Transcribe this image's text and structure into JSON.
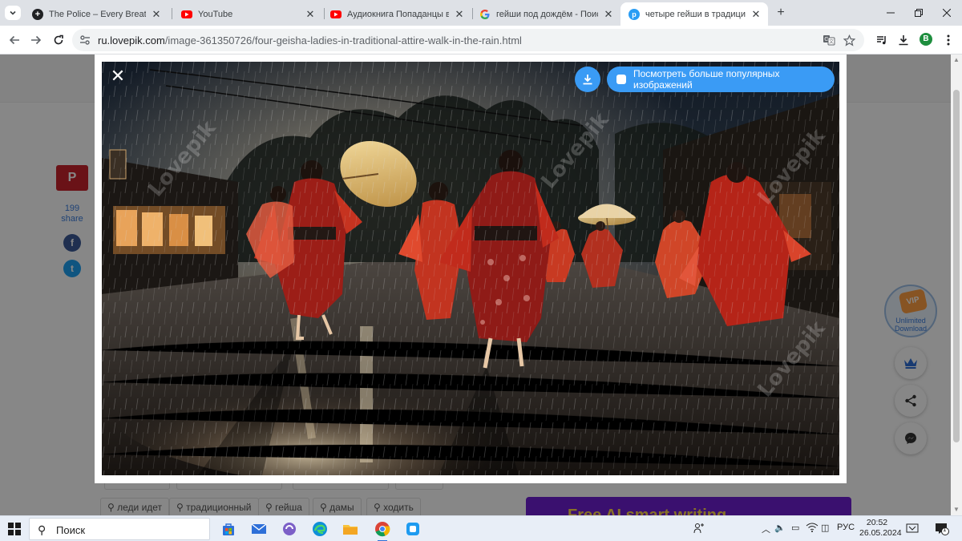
{
  "browser": {
    "tabs": [
      {
        "title": "The Police – Every Breath You Ta",
        "favicon": "plus-circle-icon",
        "close": "✕",
        "active": false
      },
      {
        "title": "YouTube",
        "favicon": "youtube-icon",
        "close": "✕",
        "active": false
      },
      {
        "title": "Аудиокнига Попаданцы в про",
        "favicon": "youtube-icon",
        "close": "✕",
        "active": false
      },
      {
        "title": "гейши под дождём - Поиск в",
        "favicon": "google-icon",
        "close": "✕",
        "active": false
      },
      {
        "title": "четыре гейши в традиционны",
        "favicon": "lovepik-icon",
        "close": "✕",
        "active": true
      }
    ],
    "new_tab_label": "+",
    "url_host": "ru.lovepik.com",
    "url_path": "/image-361350726/four-geisha-ladies-in-traditional-attire-walk-in-the-rain.html",
    "profile_initial": "B"
  },
  "page": {
    "share_count": "199",
    "share_label": "share",
    "pinterest_label": "P",
    "facebook_label": "f",
    "twitter_label": "t",
    "vip_badge_text": "VIP",
    "vip_label_line1": "Unlimited",
    "vip_label_line2": "Download",
    "tags": [
      "леди идет",
      "традиционный",
      "гейша",
      "дамы",
      "ходить"
    ],
    "promo_text": "Free AI smart writing"
  },
  "modal": {
    "close_label": "✕",
    "more_button_label": "Посмотреть больше популярных изображений",
    "watermark": "Lovepik",
    "accent_color": "#3a9bf5"
  },
  "taskbar": {
    "search_placeholder": "Поиск",
    "language": "РУС",
    "time": "20:52",
    "date": "26.05.2024",
    "notification_count": "1"
  }
}
